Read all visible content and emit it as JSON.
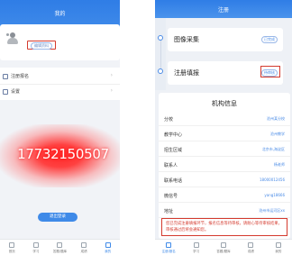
{
  "left_screen": {
    "title": "我的",
    "edit_profile_label": "编辑资料",
    "menu": [
      {
        "label": "注册报名",
        "icon": "document-icon"
      },
      {
        "label": "设置",
        "icon": "settings-icon"
      }
    ],
    "overlay_phone": "17732150507",
    "logout_label": "退出登录",
    "tabs": [
      {
        "label": "首页",
        "icon": "home-icon",
        "active": false
      },
      {
        "label": "学习",
        "icon": "study-icon",
        "active": false
      },
      {
        "label": "答题/题库",
        "icon": "quiz-icon",
        "active": false
      },
      {
        "label": "成绩",
        "icon": "score-icon",
        "active": false
      },
      {
        "label": "我的",
        "icon": "profile-icon",
        "active": true
      }
    ]
  },
  "right_screen": {
    "title": "注册",
    "steps": [
      {
        "title": "图像采集",
        "status": "已完成"
      },
      {
        "title": "注册填报",
        "status": "待审核"
      }
    ],
    "org_info": {
      "title": "机构信息",
      "fields": [
        {
          "key": "分校",
          "value": "沧州某分校"
        },
        {
          "key": "教学中心",
          "value": "沧州教学"
        },
        {
          "key": "招生区域",
          "value": "北京市,海淀区"
        },
        {
          "key": "联系人",
          "value": "杨老师"
        },
        {
          "key": "联系电话",
          "value": "18000012456"
        },
        {
          "key": "微信号",
          "value": "yang18666"
        },
        {
          "key": "地址",
          "value": "沧州市运河区xx"
        }
      ],
      "notice": "您已完成注册填报环节，报名信息等待审核，请耐心等待审核结果，审核通过后将会通知您。"
    },
    "tabs": [
      {
        "label": "注册/报名",
        "icon": "register-icon",
        "active": true
      },
      {
        "label": "学习",
        "icon": "study-icon",
        "active": false
      },
      {
        "label": "答题/题库",
        "icon": "quiz-icon",
        "active": false
      },
      {
        "label": "成绩",
        "icon": "score-icon",
        "active": false
      },
      {
        "label": "我的",
        "icon": "profile-icon",
        "active": false
      }
    ]
  },
  "colors": {
    "header_blue": "#2f7de6",
    "accent_blue": "#3f8ae8",
    "highlight_red": "#d43a2e",
    "overlay_red": "#ff2a2a"
  }
}
